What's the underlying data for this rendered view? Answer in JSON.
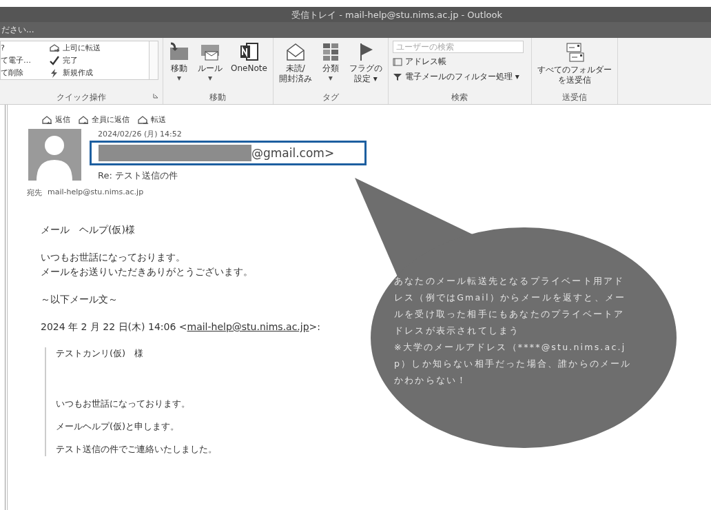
{
  "window": {
    "title": "受信トレイ - mail-help@stu.nims.ac.jp - Outlook"
  },
  "tell_me": {
    "text": "ださい..."
  },
  "ribbon": {
    "groups": [
      {
        "kind": "quick_steps",
        "label": "クイック操作",
        "items": [
          {
            "text": "?"
          },
          {
            "text": "上司に転送"
          },
          {
            "text": "て電子…"
          },
          {
            "text": "完了"
          },
          {
            "text": "て削除"
          },
          {
            "text": "新規作成"
          }
        ]
      },
      {
        "kind": "large_buttons",
        "label": "移動",
        "items": [
          {
            "lines": [
              "移動"
            ],
            "caret": "▾",
            "caret_below": true
          },
          {
            "lines": [
              "ルール"
            ],
            "caret": "▾",
            "caret_below": true
          },
          {
            "lines": [
              "OneNote"
            ]
          }
        ]
      },
      {
        "kind": "large_buttons",
        "label": "タグ",
        "items": [
          {
            "lines": [
              "未読/",
              "開封済み"
            ]
          },
          {
            "lines": [
              "分類"
            ],
            "caret": "▾",
            "caret_below": true
          },
          {
            "lines": [
              "フラグの",
              "設定"
            ],
            "caret": "▾",
            "caret_below": false
          }
        ]
      },
      {
        "kind": "search",
        "label": "検索",
        "placeholder": "ユーザーの検索",
        "items": [
          {
            "label": "アドレス帳"
          },
          {
            "label": "電子メールのフィルター処理",
            "caret": "▾"
          }
        ]
      },
      {
        "kind": "large_buttons",
        "label": "送受信",
        "items": [
          {
            "lines": [
              "すべてのフォルダー",
              "を送受信"
            ]
          }
        ]
      }
    ]
  },
  "message": {
    "actions": [
      "返信",
      "全員に返信",
      "転送"
    ],
    "date": "2024/02/26 (月) 14:52",
    "sender": {
      "redacted": true,
      "text": "@gmail.com>",
      "highlighted": true
    },
    "subject": "Re: テスト送信の件",
    "to_label": "宛先",
    "to": "mail-help@stu.nims.ac.jp",
    "body": {
      "greeting": "メール　ヘルプ(仮)様",
      "paragraphs": [
        [
          "いつもお世話になっております。",
          "メールをお送りいただきありがとうございます。"
        ],
        [
          "～以下メール文～"
        ]
      ],
      "quote_header": {
        "text": "2024 年 2 月 22 日(木) 14:06 <",
        "link": "mail-help@stu.nims.ac.jp",
        "tail": ">:"
      },
      "quoted": [
        "テストカンリ(仮)　様",
        "いつもお世話になっております。",
        "メールヘルプ(仮)と申します。",
        "テスト送信の件でご連絡いたしました。"
      ]
    }
  },
  "callout": {
    "text": "あなたのメール転送先となるプライベート用アドレス（例ではGmail）からメールを返すと、メールを受け取った相手にもあなたのプライベートアドレスが表示されてしまう\n※大学のメールアドレス（****@stu.nims.ac.jp）しか知らない相手だった場合、誰からのメールかわからない！"
  }
}
